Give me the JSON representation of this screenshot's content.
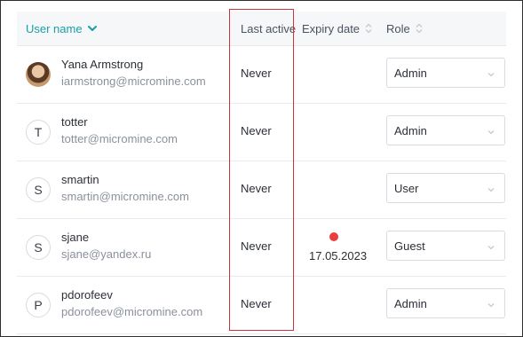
{
  "columns": {
    "user_name": "User name",
    "last_active": "Last active",
    "expiry_date": "Expiry date",
    "role": "Role"
  },
  "users": [
    {
      "name": "Yana Armstrong",
      "email": "iarmstrong@micromine.com",
      "avatar": "photo",
      "last_active": "Never",
      "expiry": "",
      "role": "Admin"
    },
    {
      "name": "totter",
      "email": "totter@micromine.com",
      "avatar": "T",
      "last_active": "Never",
      "expiry": "",
      "role": "Admin"
    },
    {
      "name": "smartin",
      "email": "smartin@micromine.com",
      "avatar": "S",
      "last_active": "Never",
      "expiry": "",
      "role": "User"
    },
    {
      "name": "sjane",
      "email": "sjane@yandex.ru",
      "avatar": "S",
      "last_active": "Never",
      "expiry": "17.05.2023",
      "expiry_alert": true,
      "role": "Guest"
    },
    {
      "name": "pdorofeev",
      "email": "pdorofeev@micromine.com",
      "avatar": "P",
      "last_active": "Never",
      "expiry": "",
      "role": "Admin"
    }
  ],
  "colors": {
    "accent": "#1aa0a6",
    "alert_dot": "#e83e3e",
    "highlight_box": "#c8353a"
  }
}
